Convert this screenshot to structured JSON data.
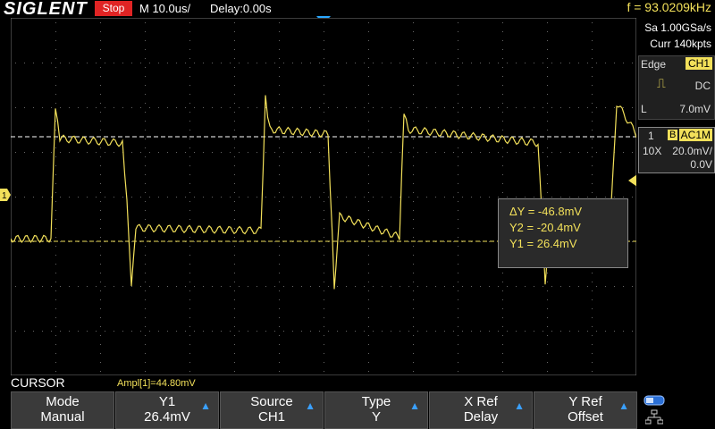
{
  "header": {
    "brand": "SIGLENT",
    "run_state": "Stop",
    "timebase": "M 10.0us/",
    "delay": "Delay:0.00s",
    "frequency": "f = 93.0209kHz"
  },
  "side": {
    "sample_rate": "Sa 1.00GSa/s",
    "memory": "Curr 140kpts",
    "trigger_mode": "Edge",
    "trigger_source": "CH1",
    "trigger_coupling": "DC",
    "trigger_level_label": "L",
    "trigger_level": "7.0mV",
    "channel_number": "1",
    "bandwidth_icon": "B",
    "channel_coupling": "AC1M",
    "probe": "10X",
    "volts_div": "20.0mV/",
    "offset": "0.0V"
  },
  "cursor_readout": {
    "delta": "ΔY = -46.8mV",
    "y2": "Y2 = -20.4mV",
    "y1": "Y1 = 26.4mV"
  },
  "bottom": {
    "title": "CURSOR",
    "measurement": "Ampl[1]=44.80mV",
    "softkeys": [
      {
        "label": "Mode",
        "value": "Manual",
        "arrow": false
      },
      {
        "label": "Y1",
        "value": "26.4mV",
        "arrow": true
      },
      {
        "label": "Source",
        "value": "CH1",
        "arrow": true
      },
      {
        "label": "Type",
        "value": "Y",
        "arrow": true
      },
      {
        "label": "X Ref",
        "value": "Delay",
        "arrow": true
      },
      {
        "label": "Y Ref",
        "value": "Offset",
        "arrow": true
      }
    ]
  },
  "channel_marker": "1",
  "colors": {
    "trace": "#f2e05a",
    "stop": "#e02424",
    "accent": "#3aa0ff"
  }
}
